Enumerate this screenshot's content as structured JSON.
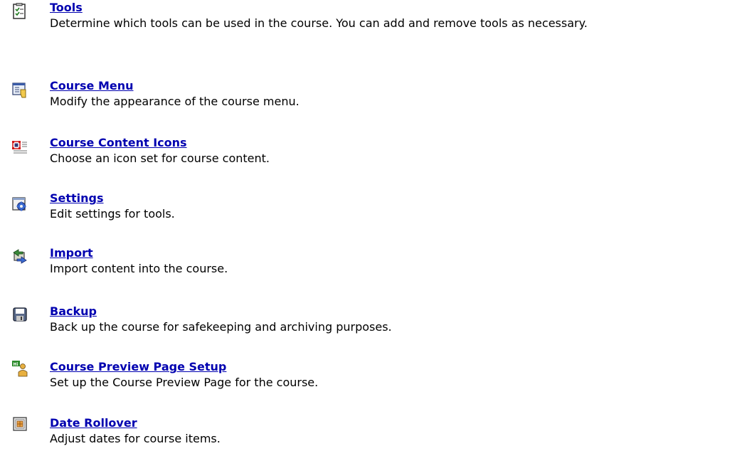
{
  "items": [
    {
      "title": "Tools",
      "description": "Determine which tools can be used in the course. You can add and remove tools as necessary.",
      "icon": "tools-icon"
    },
    {
      "title": "Course Menu",
      "description": "Modify the appearance of the course menu.",
      "icon": "course-menu-icon"
    },
    {
      "title": "Course Content Icons",
      "description": "Choose an icon set for course content.",
      "icon": "content-icons-icon"
    },
    {
      "title": "Settings",
      "description": "Edit settings for tools.",
      "icon": "settings-icon"
    },
    {
      "title": "Import",
      "description": "Import content into the course.",
      "icon": "import-icon"
    },
    {
      "title": "Backup",
      "description": "Back up the course for safekeeping and archiving purposes.",
      "icon": "backup-icon"
    },
    {
      "title": "Course Preview Page Setup",
      "description": "Set up the Course Preview Page for the course.",
      "icon": "preview-page-icon"
    },
    {
      "title": "Date Rollover",
      "description": "Adjust dates for course items.",
      "icon": "calendar-icon"
    }
  ]
}
